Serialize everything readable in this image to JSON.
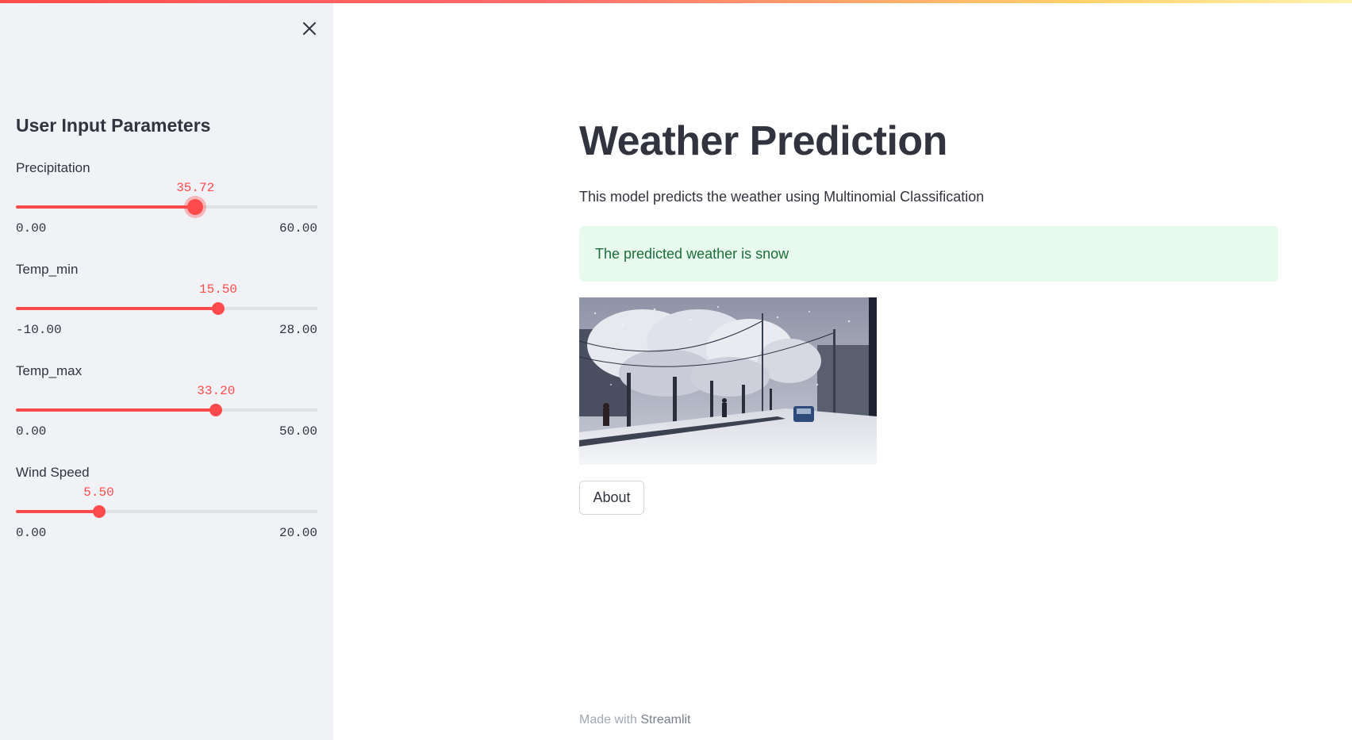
{
  "sidebar": {
    "title": "User Input Parameters",
    "sliders": [
      {
        "label": "Precipitation",
        "value": "35.72",
        "min": "0.00",
        "max": "60.00",
        "fraction": 0.5953,
        "active": true
      },
      {
        "label": "Temp_min",
        "value": "15.50",
        "min": "-10.00",
        "max": "28.00",
        "fraction": 0.6711,
        "active": false
      },
      {
        "label": "Temp_max",
        "value": "33.20",
        "min": "0.00",
        "max": "50.00",
        "fraction": 0.664,
        "active": false
      },
      {
        "label": "Wind Speed",
        "value": "5.50",
        "min": "0.00",
        "max": "20.00",
        "fraction": 0.275,
        "active": false
      }
    ]
  },
  "main": {
    "title": "Weather Prediction",
    "description": "This model predicts the weather using Multinomial Classification",
    "prediction": "The predicted weather is snow",
    "about_label": "About"
  },
  "footer": {
    "prefix": "Made with",
    "link": "Streamlit"
  },
  "colors": {
    "accent": "#ff4b4b",
    "success_bg": "#e8f9ee",
    "success_text": "#1c6e3a",
    "sidebar_bg": "#f0f2f6"
  },
  "icons": {
    "close": "close-icon"
  }
}
